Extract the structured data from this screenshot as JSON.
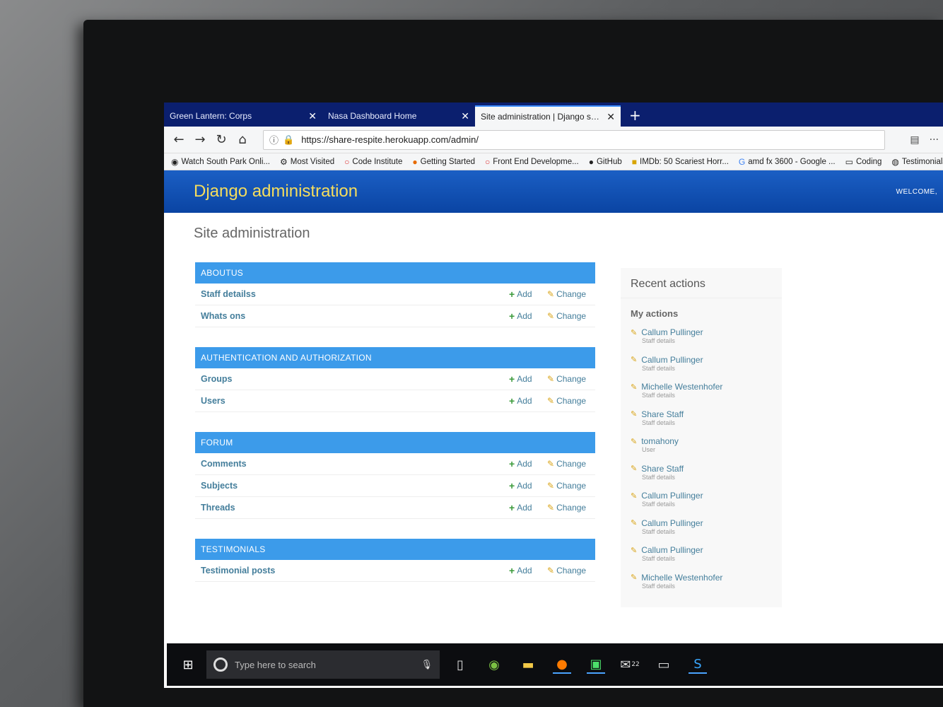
{
  "browser": {
    "tabs": [
      {
        "label": "Green Lantern: Corps",
        "active": false
      },
      {
        "label": "Nasa Dashboard Home",
        "active": false
      },
      {
        "label": "Site administration | Django site ad",
        "active": true
      }
    ],
    "new_tab": "+",
    "url": "https://share-respite.herokuapp.com/admin/",
    "bookmarks": [
      {
        "label": "Watch South Park Onli...",
        "icon": "southpark-icon"
      },
      {
        "label": "Most Visited",
        "icon": "gear-icon"
      },
      {
        "label": "Code Institute",
        "icon": "circle-icon"
      },
      {
        "label": "Getting Started",
        "icon": "firefox-icon"
      },
      {
        "label": "Front End Developme...",
        "icon": "circle-icon"
      },
      {
        "label": "GitHub",
        "icon": "github-icon"
      },
      {
        "label": "IMDb: 50 Scariest Horr...",
        "icon": "imdb-icon"
      },
      {
        "label": "amd fx 3600 - Google ...",
        "icon": "google-icon"
      },
      {
        "label": "Coding",
        "icon": "folder-icon"
      },
      {
        "label": "Testimonials",
        "icon": "globe-icon"
      }
    ]
  },
  "django": {
    "title": "Django administration",
    "welcome": "WELCOME,",
    "site_title": "Site administration",
    "add_label": "Add",
    "change_label": "Change",
    "modules": [
      {
        "caption": "ABOUTUS",
        "models": [
          "Staff detailss",
          "Whats ons"
        ]
      },
      {
        "caption": "AUTHENTICATION AND AUTHORIZATION",
        "models": [
          "Groups",
          "Users"
        ]
      },
      {
        "caption": "FORUM",
        "models": [
          "Comments",
          "Subjects",
          "Threads"
        ]
      },
      {
        "caption": "TESTIMONIALS",
        "models": [
          "Testimonial posts"
        ]
      }
    ],
    "recent": {
      "title": "Recent actions",
      "subtitle": "My actions",
      "items": [
        {
          "name": "Callum Pullinger",
          "type": "Staff details"
        },
        {
          "name": "Callum Pullinger",
          "type": "Staff details"
        },
        {
          "name": "Michelle Westenhofer",
          "type": "Staff details"
        },
        {
          "name": "Share Staff",
          "type": "Staff details"
        },
        {
          "name": "tomahony",
          "type": "User"
        },
        {
          "name": "Share Staff",
          "type": "Staff details"
        },
        {
          "name": "Callum Pullinger",
          "type": "Staff details"
        },
        {
          "name": "Callum Pullinger",
          "type": "Staff details"
        },
        {
          "name": "Callum Pullinger",
          "type": "Staff details"
        },
        {
          "name": "Michelle Westenhofer",
          "type": "Staff details"
        }
      ]
    }
  },
  "taskbar": {
    "search_placeholder": "Type here to search",
    "mail_badge": "22"
  }
}
